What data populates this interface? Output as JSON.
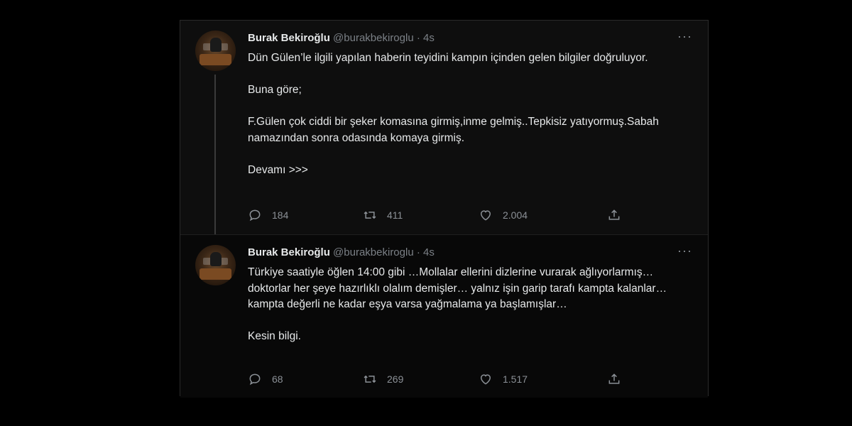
{
  "tweets": [
    {
      "author_name": "Burak Bekiroğlu",
      "handle": "@burakbekiroglu",
      "separator": "·",
      "time": "4s",
      "more_label": "···",
      "paragraphs": [
        "Dün Gülen’le ilgili yapılan haberin teyidini kampın içinden gelen bilgiler doğruluyor.",
        "Buna göre;",
        "F.Gülen çok ciddi bir şeker komasına girmiş,inme gelmiş..Tepkisiz yatıyormuş.Sabah namazından sonra odasında komaya girmiş.",
        "Devamı >>>"
      ],
      "replies": "184",
      "retweets": "411",
      "likes": "2.004"
    },
    {
      "author_name": "Burak Bekiroğlu",
      "handle": "@burakbekiroglu",
      "separator": "·",
      "time": "4s",
      "more_label": "···",
      "paragraphs": [
        "Türkiye saatiyle öğlen 14:00 gibi …Mollalar ellerini dizlerine vurarak ağlıyorlarmış… doktorlar her şeye hazırlıklı olalım demişler… yalnız işin garip tarafı kampta kalanlar…kampta değerli ne kadar eşya varsa yağmalama ya başlamışlar…",
        "Kesin bilgi."
      ],
      "replies": "68",
      "retweets": "269",
      "likes": "1.517"
    }
  ],
  "icons": {
    "reply": "reply-icon",
    "retweet": "retweet-icon",
    "like": "heart-icon",
    "share": "share-icon"
  },
  "colors": {
    "background": "#000000",
    "panel": "#0e0e0e",
    "text": "#e7e9ea",
    "muted": "#8b9096"
  }
}
